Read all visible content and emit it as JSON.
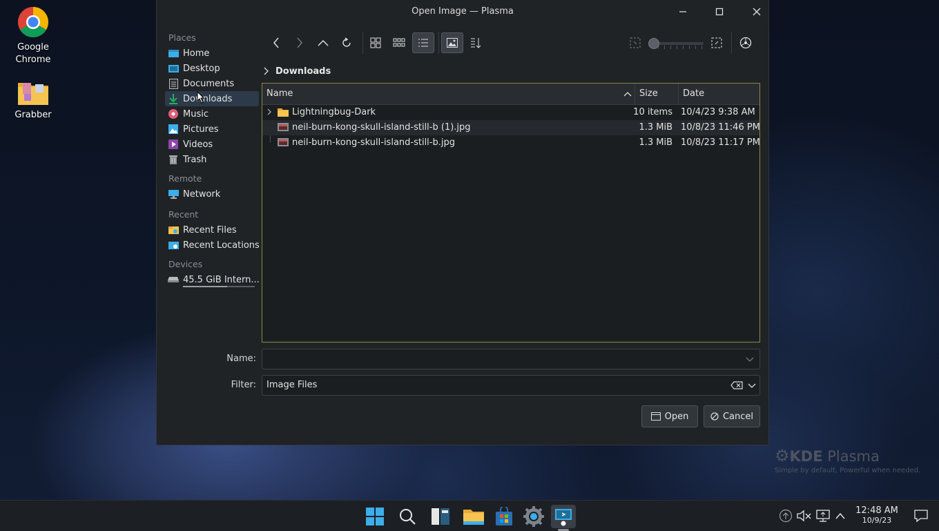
{
  "desktop": {
    "icons": [
      {
        "label_line1": "Google",
        "label_line2": "Chrome"
      },
      {
        "label_line1": "Grabber",
        "label_line2": ""
      }
    ],
    "kde_logo": {
      "brand_bold": "KDE",
      "brand_light": " Plasma",
      "tagline": "Simple by default, Powerful when  needed."
    }
  },
  "dialog": {
    "title": "Open Image — Plasma",
    "window_buttons": {
      "minimize": "–",
      "maximize": "□",
      "close": "✕"
    },
    "sidebar": {
      "sections": [
        {
          "label": "Places",
          "items": [
            {
              "label": "Home",
              "icon": "home-icon"
            },
            {
              "label": "Desktop",
              "icon": "desktop-icon"
            },
            {
              "label": "Documents",
              "icon": "documents-icon"
            },
            {
              "label": "Downloads",
              "icon": "downloads-icon"
            },
            {
              "label": "Music",
              "icon": "music-icon"
            },
            {
              "label": "Pictures",
              "icon": "pictures-icon"
            },
            {
              "label": "Videos",
              "icon": "videos-icon"
            },
            {
              "label": "Trash",
              "icon": "trash-icon"
            }
          ]
        },
        {
          "label": "Remote",
          "items": [
            {
              "label": "Network",
              "icon": "network-icon"
            }
          ]
        },
        {
          "label": "Recent",
          "items": [
            {
              "label": "Recent Files",
              "icon": "recent-files-icon"
            },
            {
              "label": "Recent Locations",
              "icon": "recent-locations-icon"
            }
          ]
        },
        {
          "label": "Devices",
          "items": [
            {
              "label": "45.5 GiB Intern...",
              "icon": "drive-icon"
            }
          ]
        }
      ],
      "active_item": "Downloads"
    },
    "breadcrumb": {
      "current": "Downloads"
    },
    "filelist": {
      "columns": {
        "name": "Name",
        "size": "Size",
        "date": "Date"
      },
      "sort": {
        "column": "Name",
        "direction": "ascending"
      },
      "rows": [
        {
          "name": "Lightningbug-Dark",
          "size": "10 items",
          "date": "10/4/23 9:38 AM",
          "type": "folder"
        },
        {
          "name": "neil-burn-kong-skull-island-still-b (1).jpg",
          "size": "1.3 MiB",
          "date": "10/8/23 11:46 PM",
          "type": "image"
        },
        {
          "name": "neil-burn-kong-skull-island-still-b.jpg",
          "size": "1.3 MiB",
          "date": "10/8/23 11:17 PM",
          "type": "image"
        }
      ]
    },
    "form": {
      "name_label": "Name:",
      "name_value": "",
      "filter_label": "Filter:",
      "filter_value": "Image Files"
    },
    "buttons": {
      "open": "Open",
      "cancel": "Cancel"
    },
    "colors": {
      "accent": "#3daee9",
      "focus_border": "#8a8a45",
      "background": "#202326"
    }
  },
  "taskbar": {
    "clock": {
      "time": "12:48 AM",
      "date": "10/9/23"
    },
    "apps": [
      "start-icon",
      "search-icon",
      "task-view-icon",
      "file-manager-icon",
      "store-icon",
      "settings-icon",
      "spectacle-icon"
    ]
  }
}
